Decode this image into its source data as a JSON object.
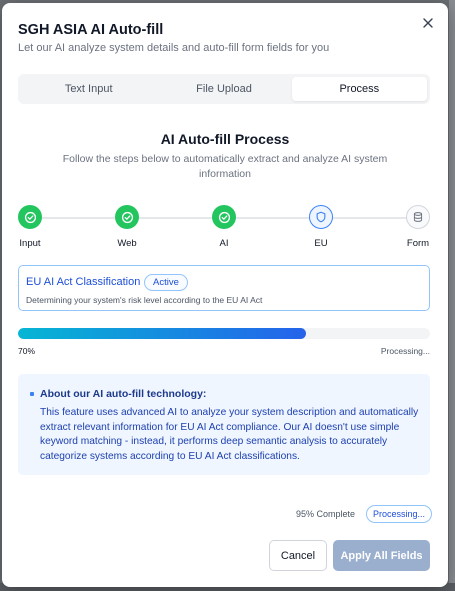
{
  "dialog": {
    "title": "SGH ASIA AI Auto-fill",
    "subtitle": "Let our AI analyze system details and auto-fill form fields for you",
    "close_icon": "close-icon"
  },
  "tabs": [
    {
      "label": "Text Input",
      "active": false
    },
    {
      "label": "File Upload",
      "active": false
    },
    {
      "label": "Process",
      "active": true
    }
  ],
  "process": {
    "title": "AI Auto-fill Process",
    "description": "Follow the steps below to automatically extract and analyze AI system information"
  },
  "steps": [
    {
      "label": "Input",
      "state": "done",
      "icon": "check-circle-icon"
    },
    {
      "label": "Web",
      "state": "done",
      "icon": "check-circle-icon"
    },
    {
      "label": "AI",
      "state": "done",
      "icon": "check-circle-icon"
    },
    {
      "label": "EU",
      "state": "current",
      "icon": "shield-icon"
    },
    {
      "label": "Form",
      "state": "pending",
      "icon": "database-icon"
    }
  ],
  "active_step": {
    "title": "EU AI Act Classification",
    "badge": "Active",
    "description": "Determining your system's risk level according to the EU AI Act"
  },
  "progress": {
    "value": 0.7,
    "percent_label": "70%",
    "status": "Processing..."
  },
  "info": {
    "title": "About our AI auto-fill technology:",
    "body": "This feature uses advanced AI to analyze your system description and automatically extract relevant information for EU AI Act compliance. Our AI doesn't use simple keyword matching - instead, it performs deep semantic analysis to accurately categorize systems according to EU AI Act classifications."
  },
  "footer": {
    "complete_label": "95% Complete",
    "status_badge": "Processing...",
    "cancel_label": "Cancel",
    "apply_label": "Apply All Fields"
  },
  "colors": {
    "done": "#22c55e",
    "accent": "#2563eb",
    "apply_disabled": "#9aaecd"
  }
}
